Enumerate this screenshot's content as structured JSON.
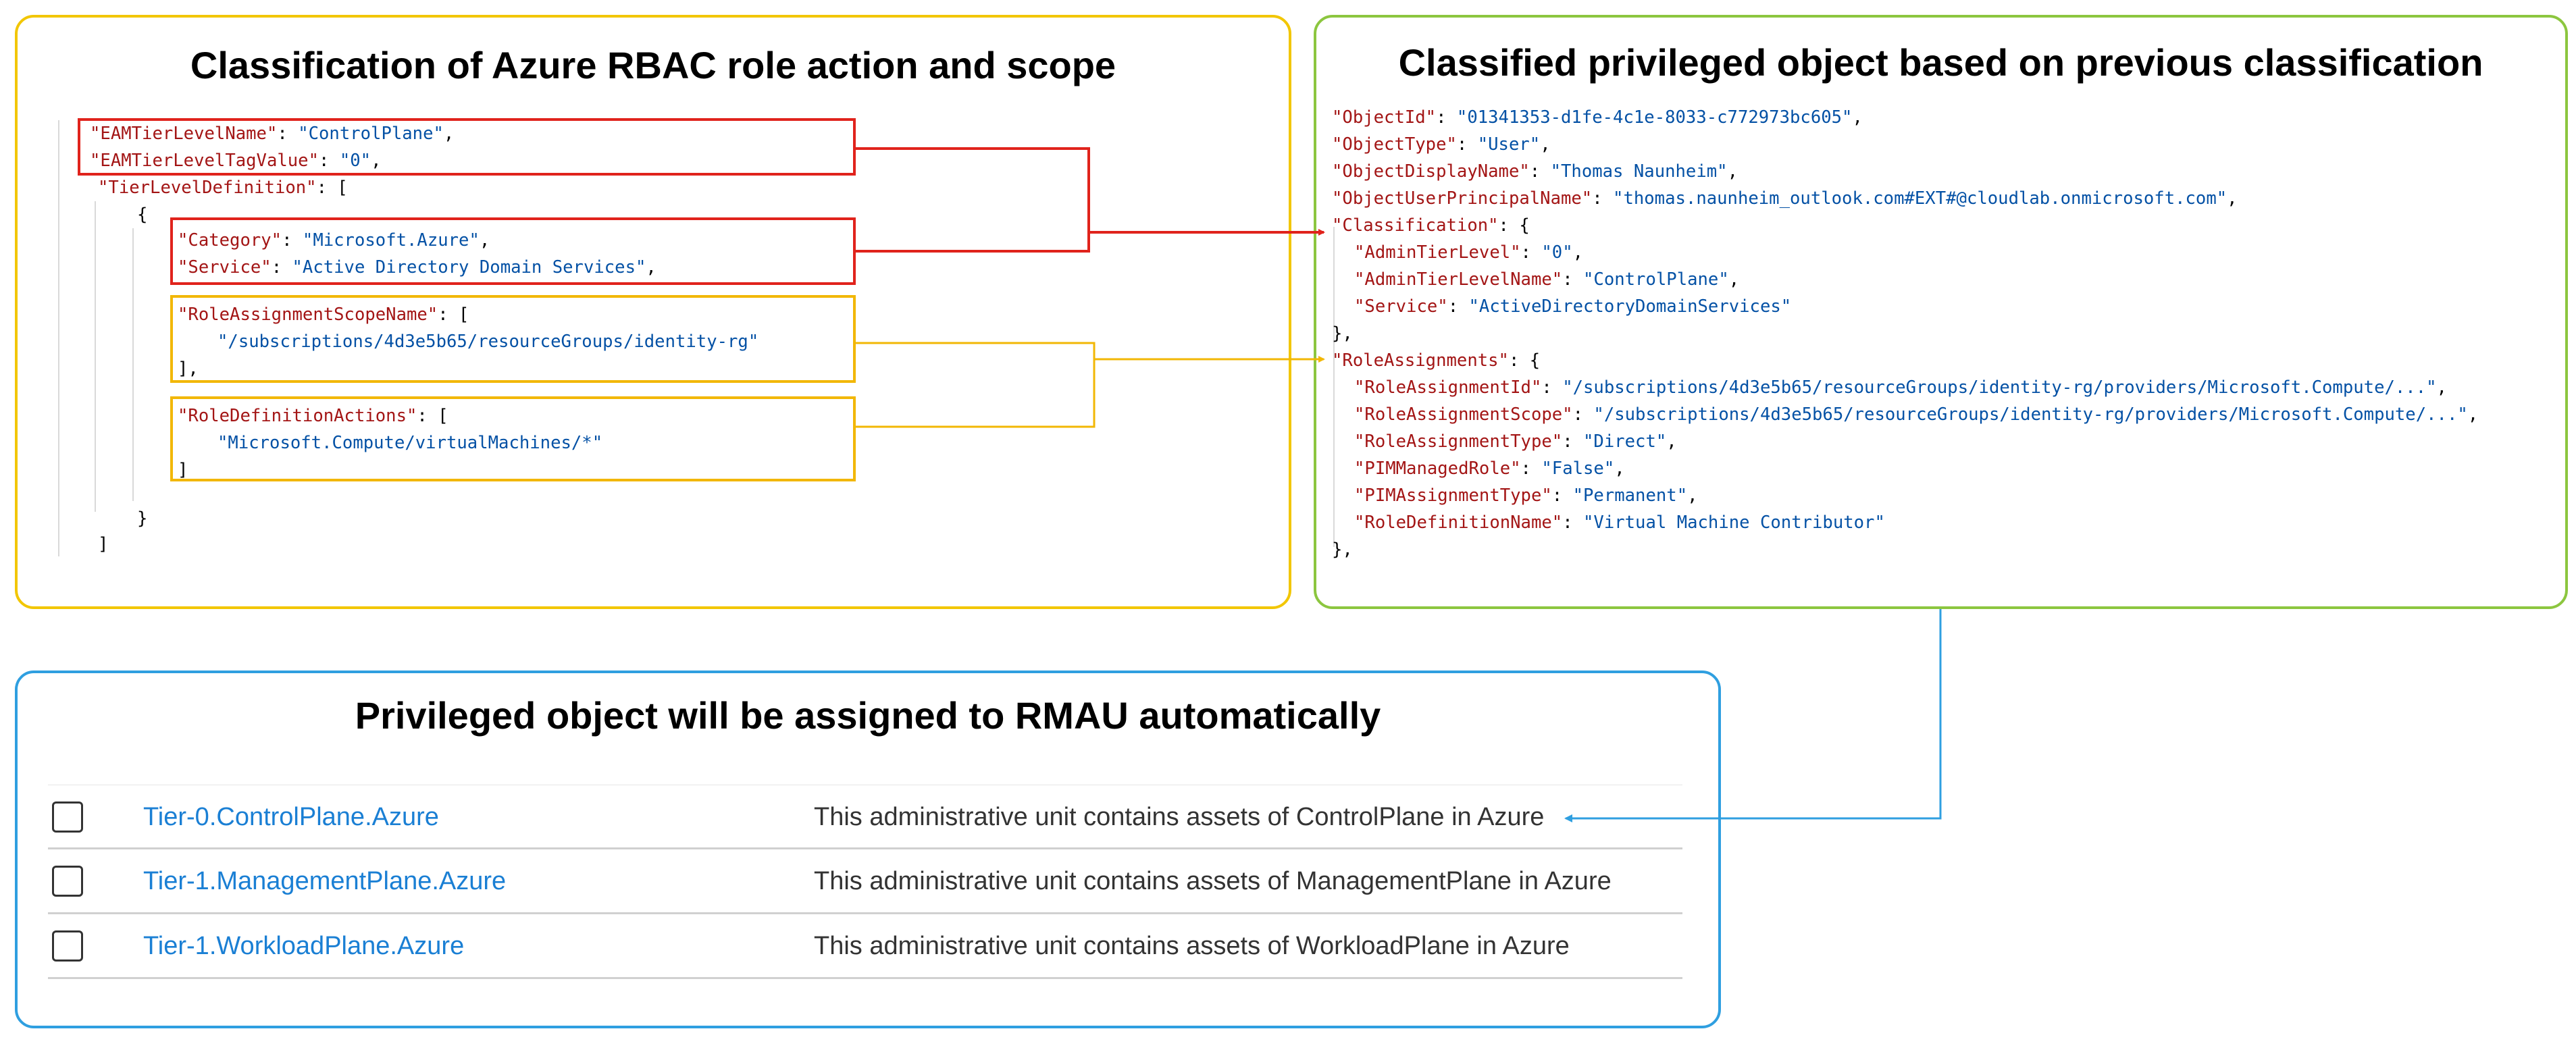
{
  "colors": {
    "left_border": "#f2c600",
    "right_border": "#8cc63f",
    "bottom_border": "#2f9fe0",
    "red_highlight": "#e0231c",
    "yellow_highlight": "#f2b705",
    "json_key": "#a31515",
    "json_value": "#0451a5",
    "link": "#1a7fd4"
  },
  "left": {
    "title": "Classification of Azure RBAC role action and scope",
    "lines": [
      {
        "k": "\"EAMTierLevelName\"",
        "p": ": ",
        "v": "\"ControlPlane\"",
        "s": ","
      },
      {
        "k": "\"EAMTierLevelTagValue\"",
        "p": ": ",
        "v": "\"0\"",
        "s": ","
      },
      {
        "k": "\"TierLevelDefinition\"",
        "p": ": [",
        "v": "",
        "s": ""
      },
      {
        "k": "",
        "p": "{",
        "v": "",
        "s": ""
      },
      {
        "k": "\"Category\"",
        "p": ": ",
        "v": "\"Microsoft.Azure\"",
        "s": ","
      },
      {
        "k": "\"Service\"",
        "p": ": ",
        "v": "\"Active Directory Domain Services\"",
        "s": ","
      },
      {
        "k": "\"RoleAssignmentScopeName\"",
        "p": ": [",
        "v": "",
        "s": ""
      },
      {
        "k": "",
        "p": "",
        "v": "\"/subscriptions/4d3e5b65/resourceGroups/identity-rg\"",
        "s": ""
      },
      {
        "k": "",
        "p": "],",
        "v": "",
        "s": ""
      },
      {
        "k": "\"RoleDefinitionActions\"",
        "p": ": [",
        "v": "",
        "s": ""
      },
      {
        "k": "",
        "p": "",
        "v": "\"Microsoft.Compute/virtualMachines/*\"",
        "s": ""
      },
      {
        "k": "",
        "p": "]",
        "v": "",
        "s": ""
      },
      {
        "k": "",
        "p": "}",
        "v": "",
        "s": ""
      },
      {
        "k": "",
        "p": "]",
        "v": "",
        "s": ""
      }
    ]
  },
  "right": {
    "title": "Classified privileged object based on previous classification",
    "lines": [
      {
        "k": "\"ObjectId\"",
        "p": ": ",
        "v": "\"01341353-d1fe-4c1e-8033-c772973bc605\"",
        "s": ","
      },
      {
        "k": "\"ObjectType\"",
        "p": ": ",
        "v": "\"User\"",
        "s": ","
      },
      {
        "k": "\"ObjectDisplayName\"",
        "p": ": ",
        "v": "\"Thomas Naunheim\"",
        "s": ","
      },
      {
        "k": "\"ObjectUserPrincipalName\"",
        "p": ": ",
        "v": "\"thomas.naunheim_outlook.com#EXT#@cloudlab.onmicrosoft.com\"",
        "s": ","
      },
      {
        "k": "\"Classification\"",
        "p": ": {",
        "v": "",
        "s": ""
      },
      {
        "k": "\"AdminTierLevel\"",
        "p": ": ",
        "v": "\"0\"",
        "s": ","
      },
      {
        "k": "\"AdminTierLevelName\"",
        "p": ": ",
        "v": "\"ControlPlane\"",
        "s": ","
      },
      {
        "k": "\"Service\"",
        "p": ": ",
        "v": "\"ActiveDirectoryDomainServices\"",
        "s": ""
      },
      {
        "k": "",
        "p": "},",
        "v": "",
        "s": ""
      },
      {
        "k": "\"RoleAssignments\"",
        "p": ": {",
        "v": "",
        "s": ""
      },
      {
        "k": "\"RoleAssignmentId\"",
        "p": ": ",
        "v": "\"/subscriptions/4d3e5b65/resourceGroups/identity-rg/providers/Microsoft.Compute/...\"",
        "s": ","
      },
      {
        "k": "\"RoleAssignmentScope\"",
        "p": ": ",
        "v": "\"/subscriptions/4d3e5b65/resourceGroups/identity-rg/providers/Microsoft.Compute/...\"",
        "s": ","
      },
      {
        "k": "\"RoleAssignmentType\"",
        "p": ": ",
        "v": "\"Direct\"",
        "s": ","
      },
      {
        "k": "\"PIMManagedRole\"",
        "p": ": ",
        "v": "\"False\"",
        "s": ","
      },
      {
        "k": "\"PIMAssignmentType\"",
        "p": ": ",
        "v": "\"Permanent\"",
        "s": ","
      },
      {
        "k": "\"RoleDefinitionName\"",
        "p": ": ",
        "v": "\"Virtual Machine Contributor\"",
        "s": ""
      },
      {
        "k": "",
        "p": "},",
        "v": "",
        "s": ""
      }
    ]
  },
  "bottom": {
    "title": "Privileged object will be assigned to RMAU automatically",
    "rows": [
      {
        "name": "Tier-0.ControlPlane.Azure",
        "description": "This administrative unit contains assets of ControlPlane in Azure"
      },
      {
        "name": "Tier-1.ManagementPlane.Azure",
        "description": "This administrative unit contains assets of ManagementPlane in Azure"
      },
      {
        "name": "Tier-1.WorkloadPlane.Azure",
        "description": "This administrative unit contains assets of WorkloadPlane in Azure"
      }
    ]
  }
}
